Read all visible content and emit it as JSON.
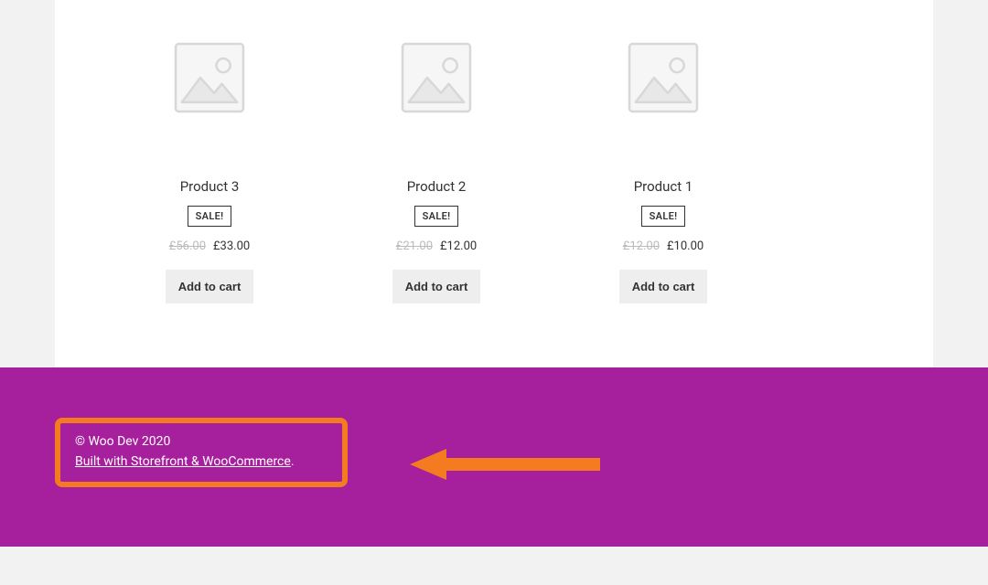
{
  "products": [
    {
      "title": "Product 3",
      "sale": "SALE!",
      "old_price": "£56.00",
      "new_price": "£33.00",
      "cta": "Add to cart"
    },
    {
      "title": "Product 2",
      "sale": "SALE!",
      "old_price": "£21.00",
      "new_price": "£12.00",
      "cta": "Add to cart"
    },
    {
      "title": "Product 1",
      "sale": "SALE!",
      "old_price": "£12.00",
      "new_price": "£10.00",
      "cta": "Add to cart"
    }
  ],
  "footer": {
    "copyright": "© Woo Dev 2020",
    "built_with_link": "Built with Storefront & WooCommerce",
    "built_with_suffix": "."
  }
}
